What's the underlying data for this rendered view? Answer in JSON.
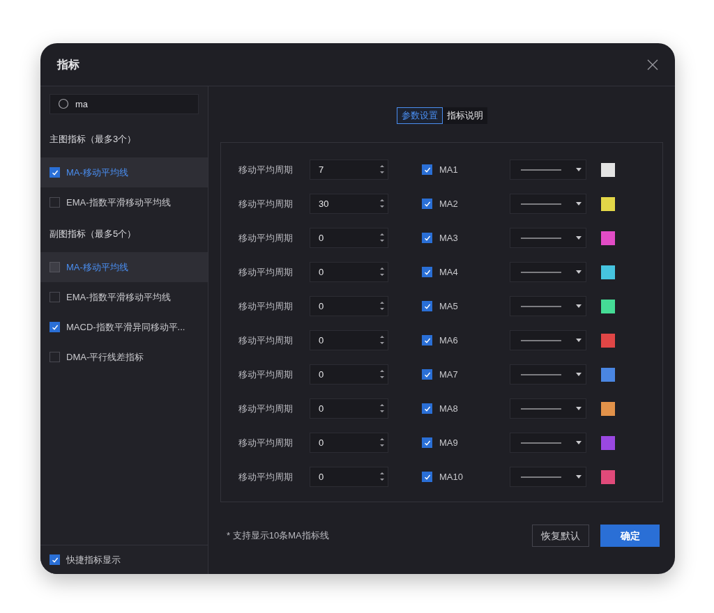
{
  "dialog": {
    "title": "指标"
  },
  "search": {
    "value": "ma"
  },
  "groups": [
    {
      "heading": "主图指标（最多3个）",
      "items": [
        {
          "label": "MA-移动平均线",
          "checked": true,
          "selected": true
        },
        {
          "label": "EMA-指数平滑移动平均线",
          "checked": false,
          "selected": false
        }
      ]
    },
    {
      "heading": "副图指标（最多5个）",
      "items": [
        {
          "label": "MA-移动平均线",
          "checked": false,
          "selected": true
        },
        {
          "label": "EMA-指数平滑移动平均线",
          "checked": false,
          "selected": false
        },
        {
          "label": "MACD-指数平滑异同移动平...",
          "checked": true,
          "selected": false
        },
        {
          "label": "DMA-平行线差指标",
          "checked": false,
          "selected": false
        }
      ]
    }
  ],
  "quick_display": {
    "label": "快捷指标显示",
    "checked": true
  },
  "tabs": [
    {
      "label": "参数设置",
      "selected": true
    },
    {
      "label": "指标说明",
      "selected": false
    }
  ],
  "rows": [
    {
      "label": "移动平均周期",
      "value": "7",
      "checked": true,
      "name": "MA1",
      "color": "#e3e3e3"
    },
    {
      "label": "移动平均周期",
      "value": "30",
      "checked": true,
      "name": "MA2",
      "color": "#e3d748"
    },
    {
      "label": "移动平均周期",
      "value": "0",
      "checked": true,
      "name": "MA3",
      "color": "#e24cc6"
    },
    {
      "label": "移动平均周期",
      "value": "0",
      "checked": true,
      "name": "MA4",
      "color": "#46c4e0"
    },
    {
      "label": "移动平均周期",
      "value": "0",
      "checked": true,
      "name": "MA5",
      "color": "#45dc96"
    },
    {
      "label": "移动平均周期",
      "value": "0",
      "checked": true,
      "name": "MA6",
      "color": "#e04646"
    },
    {
      "label": "移动平均周期",
      "value": "0",
      "checked": true,
      "name": "MA7",
      "color": "#4a86e2"
    },
    {
      "label": "移动平均周期",
      "value": "0",
      "checked": true,
      "name": "MA8",
      "color": "#e2924a"
    },
    {
      "label": "移动平均周期",
      "value": "0",
      "checked": true,
      "name": "MA9",
      "color": "#9a48e2"
    },
    {
      "label": "移动平均周期",
      "value": "0",
      "checked": true,
      "name": "MA10",
      "color": "#e04a7a"
    }
  ],
  "note": "* 支持显示10条MA指标线",
  "buttons": {
    "reset": "恢复默认",
    "confirm": "确定"
  }
}
